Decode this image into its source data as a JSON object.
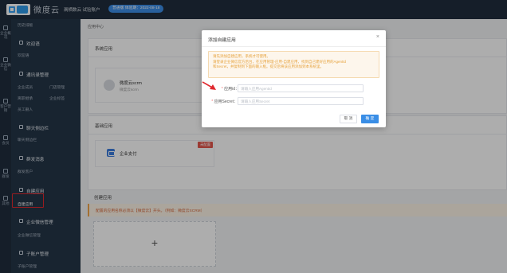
{
  "topbar": {
    "logo_text": "微度云",
    "company": "鬲栖数云 试验账户",
    "badge": "普通版 体验期：2022-08-18"
  },
  "rail": [
    {
      "label": "企业概况"
    },
    {
      "label": "企业微信"
    },
    {
      "label": "客户营销"
    },
    {
      "label": "会员"
    },
    {
      "label": "群发"
    },
    {
      "label": "其他"
    }
  ],
  "sidebar": {
    "groups": [
      {
        "title": "历史排版",
        "subs": []
      },
      {
        "title": "欢迎语",
        "subs": [
          "欢迎语"
        ]
      },
      {
        "title": "通讯录管理",
        "subs": [
          "企业成员",
          "门店管理",
          "离职继承",
          "企业标签",
          "员工删人"
        ]
      },
      {
        "title": "聊天侧边栏",
        "subs": [
          "聊天侧边栏"
        ]
      },
      {
        "title": "群发消息",
        "subs": [
          "群发客户"
        ]
      },
      {
        "title": "自建应用",
        "subs": [
          "自建应用"
        ]
      },
      {
        "title": "企业微信管理",
        "subs": [
          "企业微信管理"
        ]
      },
      {
        "title": "子账户管理",
        "subs": [
          "子账户管理"
        ]
      }
    ]
  },
  "main": {
    "breadcrumb": "应用中心",
    "system_apps": {
      "title": "系统应用",
      "app_name": "微度云scrm",
      "app_sub": "微度云scrm"
    },
    "basic_apps": {
      "title": "基础应用",
      "app_name": "企业支付",
      "tag": "未配置"
    },
    "custom_apps": {
      "title": "创建应用",
      "warning": "配置的应用名称必须以【微度云】开头。（例如：微度云SCRM）",
      "add_label": "+"
    }
  },
  "modal": {
    "title": "添加自建应用",
    "close": "×",
    "notice_lines": [
      "请先添加自建应用，系统才可使用。",
      "请登录企业微信官方后台，在应用管理-应用-自建应用，找到自己建好应用的AgentId",
      "和Secret，并复制到下面的输入框。提交后将该应用添加到本系统里。"
    ],
    "fields": [
      {
        "label": "应用id：",
        "placeholder": "请输入应用AgentId",
        "value": ""
      },
      {
        "label": "应用Secret：",
        "placeholder": "请输入应用Secret",
        "value": ""
      }
    ],
    "cancel_label": "取 消",
    "ok_label": "确 定"
  },
  "colors": {
    "sidebar_bg": "#243547",
    "topbar_bg": "#1f2d3d",
    "primary": "#3a8ee6",
    "warning": "#e6a23c",
    "annotation_red": "#e0282e"
  }
}
